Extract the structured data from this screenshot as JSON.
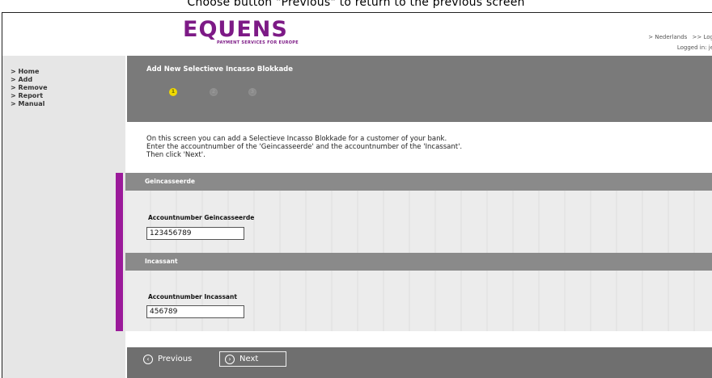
{
  "caption": "Choose button \"Previous\" to return to the previous screen",
  "brand": {
    "name": "EQUENS",
    "tagline": "PAYMENT SERVICES FOR EUROPE",
    "color": "#7d1a86"
  },
  "top_links": {
    "language": "> Nederlands",
    "logout": ">> Log"
  },
  "logged_in": "Logged in: je",
  "sidebar": {
    "items": [
      {
        "label": "> Home"
      },
      {
        "label": "> Add"
      },
      {
        "label": "> Remove"
      },
      {
        "label": "> Report"
      },
      {
        "label": "> Manual"
      }
    ]
  },
  "header": {
    "title": "Add New Selectieve Incasso Blokkade",
    "steps": [
      "1",
      "2",
      "3"
    ],
    "active_step": 1
  },
  "intro": {
    "line1": "On this screen you can add a Selectieve Incasso Blokkade for a customer of your bank.",
    "line2": "Enter the accountnumber of the 'Geincasseerde' and the accountnumber of the 'Incassant'.",
    "line3": "Then click 'Next'."
  },
  "sections": {
    "geincasseerde": {
      "heading": "Geincasseerde",
      "field_label": "Accountnumber Geincasseerde",
      "value": "123456789"
    },
    "incassant": {
      "heading": "Incassant",
      "field_label": "Accountnumber Incassant",
      "value": "456789"
    }
  },
  "footer": {
    "previous_label": "Previous",
    "next_label": "Next"
  },
  "colors": {
    "header_gray": "#7a7a7a",
    "section_gray": "#8a8a8a",
    "accent_purple": "#9b1a9a",
    "step_active": "#f1d900"
  }
}
